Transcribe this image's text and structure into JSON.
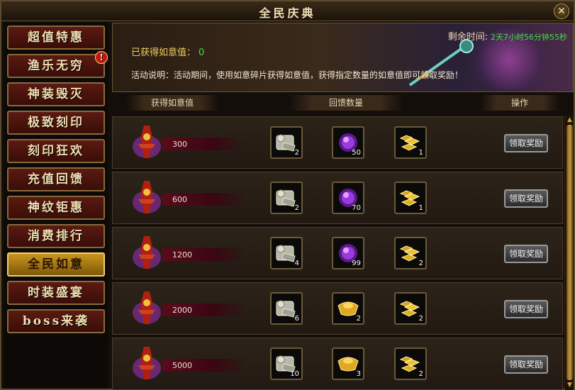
{
  "window": {
    "title": "全民庆典",
    "close_symbol": "✕"
  },
  "sidebar": {
    "items": [
      {
        "label": "超值特惠",
        "active": false,
        "alert": false
      },
      {
        "label": "渔乐无穷",
        "active": false,
        "alert": true
      },
      {
        "label": "神装毁灭",
        "active": false,
        "alert": false
      },
      {
        "label": "极致刻印",
        "active": false,
        "alert": false
      },
      {
        "label": "刻印狂欢",
        "active": false,
        "alert": false
      },
      {
        "label": "充值回馈",
        "active": false,
        "alert": false
      },
      {
        "label": "神纹钜惠",
        "active": false,
        "alert": false
      },
      {
        "label": "消费排行",
        "active": false,
        "alert": false
      },
      {
        "label": "全民如意",
        "active": true,
        "alert": false
      },
      {
        "label": "时装盛宴",
        "active": false,
        "alert": false
      },
      {
        "label": "boss来袭",
        "active": false,
        "alert": false
      }
    ],
    "alert_symbol": "!"
  },
  "banner": {
    "ruyi_label": "已获得如意值：",
    "ruyi_value": "0",
    "description": "活动说明：活动期间，使用如意碎片获得如意值，获得指定数量的如意值即可领取奖励！",
    "remaining_label": "剩余时间:",
    "remaining_value": "2天7小时56分钟55秒"
  },
  "headers": {
    "value": "获得如意值",
    "rewards": "回馈数量",
    "action": "操作"
  },
  "claim_label": "领取奖励",
  "rows": [
    {
      "requirement": "300",
      "rewards": [
        {
          "icon": "scroll-icon",
          "qty": "2"
        },
        {
          "icon": "purple-orb-icon",
          "qty": "50"
        },
        {
          "icon": "gold-bars-icon",
          "qty": "1"
        }
      ]
    },
    {
      "requirement": "600",
      "rewards": [
        {
          "icon": "scroll-icon",
          "qty": "2"
        },
        {
          "icon": "purple-orb-icon",
          "qty": "70"
        },
        {
          "icon": "gold-bars-icon",
          "qty": "1"
        }
      ]
    },
    {
      "requirement": "1200",
      "rewards": [
        {
          "icon": "scroll-icon",
          "qty": "4"
        },
        {
          "icon": "purple-orb-icon",
          "qty": "99"
        },
        {
          "icon": "gold-bars-icon",
          "qty": "2"
        }
      ]
    },
    {
      "requirement": "2000",
      "rewards": [
        {
          "icon": "scroll-icon",
          "qty": "6"
        },
        {
          "icon": "gold-ingot-icon",
          "qty": "2"
        },
        {
          "icon": "gold-bars-icon",
          "qty": "2"
        }
      ]
    },
    {
      "requirement": "5000",
      "rewards": [
        {
          "icon": "scroll-icon",
          "qty": "10"
        },
        {
          "icon": "gold-ingot-icon",
          "qty": "3"
        },
        {
          "icon": "gold-bars-icon",
          "qty": "2"
        }
      ]
    }
  ],
  "colors": {
    "accent_gold": "#f0d060",
    "value_green": "#40e040",
    "active_tab": "#c9951e",
    "tab_red": "#5a1a12"
  }
}
